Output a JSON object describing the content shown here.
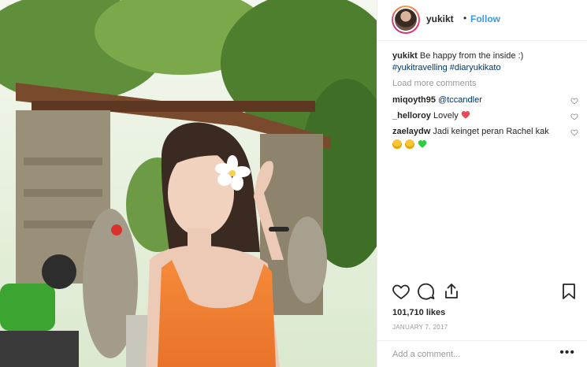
{
  "header": {
    "username": "yukikt",
    "separator": "•",
    "follow_label": "Follow"
  },
  "caption": {
    "username": "yukikt",
    "text": "Be happy from the inside :)",
    "hashtags": "#yukitravelling #diaryukikato"
  },
  "load_more_label": "Load more comments",
  "comments": [
    {
      "username": "miqoyth95",
      "text": "@tccandler",
      "emoji": []
    },
    {
      "username": "_helloroy",
      "text": "Lovely",
      "emoji": [
        "red-heart"
      ]
    },
    {
      "username": "zaelaydw",
      "text": "Jadi keinget peran Rachel kak",
      "emoji": [
        "grinning-sweat-face",
        "grinning-sweat-face",
        "green-heart"
      ]
    }
  ],
  "likes_text": "101,710 likes",
  "date_text": "JANUARY 7, 2017",
  "add_comment_placeholder": "Add a comment...",
  "more_options_label": "•••",
  "icons": {
    "like": "heart-outline-icon",
    "comment": "speech-bubble-icon",
    "share": "share-icon",
    "save": "bookmark-icon"
  },
  "colors": {
    "link_blue": "#3897f0",
    "hashtag_blue": "#003569",
    "muted_gray": "#999999",
    "heart_red": "#ed4956",
    "green_heart": "#2ecc40"
  }
}
